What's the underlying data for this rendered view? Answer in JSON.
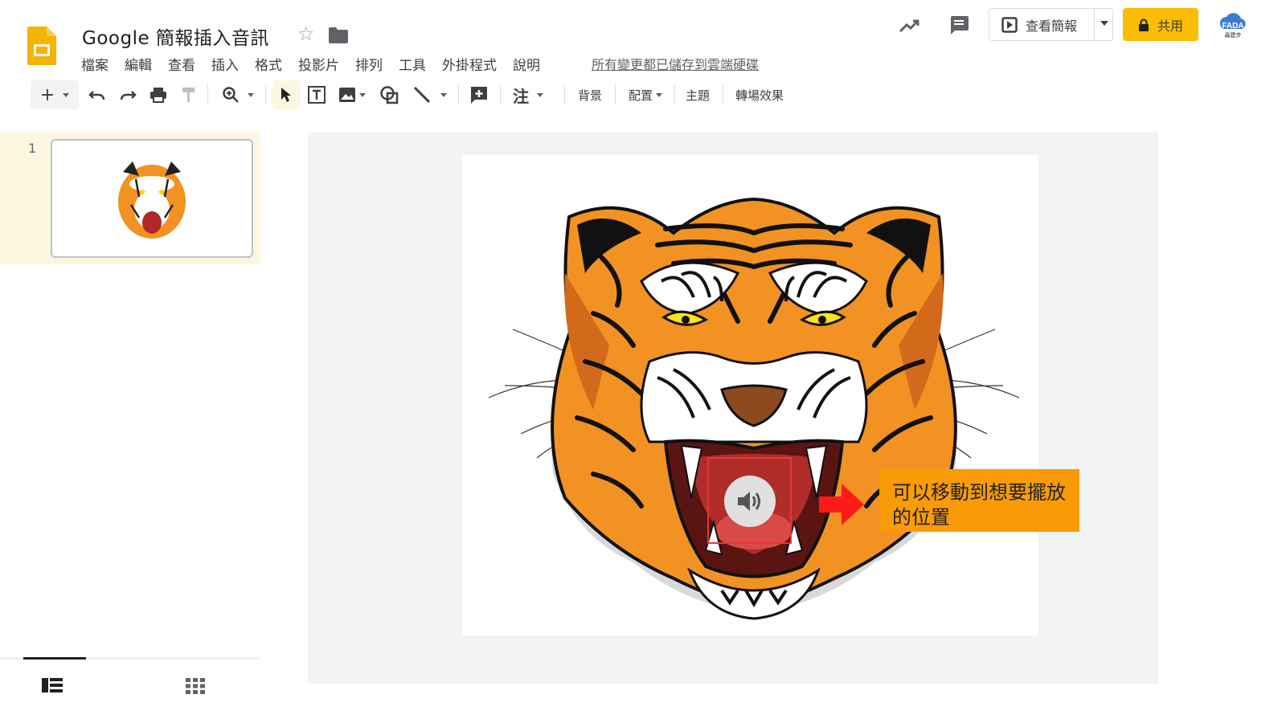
{
  "header": {
    "title": "Google 簡報插入音訊",
    "menu": [
      "檔案",
      "編輯",
      "查看",
      "插入",
      "格式",
      "投影片",
      "排列",
      "工具",
      "外掛程式",
      "說明"
    ],
    "save_status": "所有變更都已儲存到雲端硬碟",
    "present_label": "查看簡報",
    "share_label": "共用",
    "avatar_text": "FADA",
    "avatar_subtext": "尋建步",
    "brand_color": "#fbbc04"
  },
  "toolbar": {
    "comment_label": "注",
    "background_label": "背景",
    "layout_label": "配置",
    "theme_label": "主題",
    "transition_label": "轉場效果",
    "icons": [
      "add-icon",
      "undo-icon",
      "redo-icon",
      "print-icon",
      "paint-format-icon",
      "zoom-icon",
      "select-icon",
      "text-box-icon",
      "image-icon",
      "shape-icon",
      "line-icon",
      "new-comment-icon"
    ]
  },
  "filmstrip": {
    "slide_number": "1"
  },
  "slide": {
    "callout_text": "可以移動到想要擺放的位置",
    "callout_color": "#f99b06",
    "highlight_color": "#e53935",
    "arrow_color": "#ff1a1a",
    "icons": [
      "speaker-icon",
      "tiger-image"
    ]
  }
}
